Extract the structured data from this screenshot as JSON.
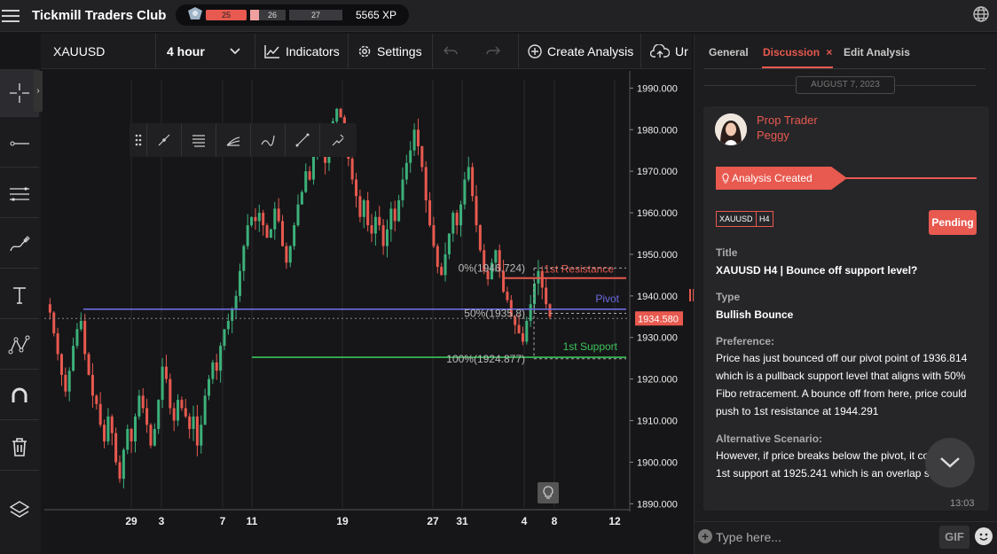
{
  "app": {
    "title": "Tickmill Traders Club"
  },
  "xp": {
    "seg1": "25",
    "seg2": "26",
    "seg3": "27",
    "value": "5565 XP"
  },
  "toolbar": {
    "symbol": "XAUUSD",
    "timeframe": "4 hour",
    "indicators": "Indicators",
    "settings": "Settings",
    "create_analysis": "Create Analysis",
    "upload": "Ur"
  },
  "chart_data": {
    "type": "candlestick",
    "symbol": "XAUUSD",
    "timeframe": "4 hour",
    "ylim": [
      1889,
      1992
    ],
    "y_ticks": [
      "1990.000",
      "1980.000",
      "1970.000",
      "1960.000",
      "1950.000",
      "1940.000",
      "1930.000",
      "1920.000",
      "1910.000",
      "1900.000",
      "1890.000"
    ],
    "x_ticks": [
      "29",
      "3",
      "7",
      "11",
      "19",
      "27",
      "31",
      "4",
      "8",
      "12"
    ],
    "current_price": "1934.580",
    "levels": [
      {
        "label": "1st Resistance",
        "price": 1944.291,
        "color": "#e8594f"
      },
      {
        "label": "Pivot",
        "price": 1936.814,
        "color": "#6c6ce0"
      },
      {
        "label": "1st Support",
        "price": 1925.241,
        "color": "#3cc35a"
      }
    ],
    "fib_labels": [
      "0%(1946.724)",
      "50%(1935.8)",
      "100%(1924.877)"
    ],
    "path": [
      1938,
      1936,
      1931,
      1926,
      1921,
      1917,
      1922,
      1928,
      1932,
      1934,
      1926,
      1921,
      1916,
      1914,
      1909,
      1905,
      1911,
      1907,
      1900,
      1896,
      1903,
      1908,
      1905,
      1911,
      1916,
      1913,
      1909,
      1904,
      1908,
      1915,
      1923,
      1920,
      1913,
      1910,
      1915,
      1913,
      1911,
      1908,
      1911,
      1904,
      1909,
      1916,
      1920,
      1924,
      1922,
      1928,
      1932,
      1934,
      1937,
      1940,
      1946,
      1952,
      1957,
      1959,
      1958,
      1960,
      1957,
      1954,
      1956,
      1961,
      1958,
      1952,
      1948,
      1952,
      1957,
      1962,
      1965,
      1970,
      1968,
      1975,
      1979,
      1977,
      1972,
      1976,
      1982,
      1985,
      1983,
      1976,
      1973,
      1968,
      1964,
      1959,
      1963,
      1957,
      1955,
      1959,
      1957,
      1952,
      1956,
      1961,
      1958,
      1963,
      1968,
      1972,
      1975,
      1980,
      1976,
      1971,
      1963,
      1957,
      1952,
      1947,
      1945,
      1950,
      1955,
      1960,
      1957,
      1962,
      1968,
      1971,
      1964,
      1957,
      1951,
      1946,
      1944,
      1948,
      1951,
      1946,
      1941,
      1939,
      1935,
      1933,
      1931,
      1929,
      1934,
      1938,
      1943,
      1946,
      1942,
      1938,
      1935
    ],
    "ohlc_note": ""
  },
  "side": {
    "tabs": [
      "General",
      "Discussion",
      "Edit Analysis"
    ],
    "date": "AUGUST 7, 2023",
    "author_role": "Prop Trader",
    "author_name": "Peggy",
    "banner": "Analysis Created",
    "tags": [
      "XAUUSD",
      "H4"
    ],
    "status": "Pending",
    "title_label": "Title",
    "title_value": "XAUUSD H4 | Bounce off support level?",
    "type_label": "Type",
    "type_value": "Bullish Bounce",
    "pref_label": "Preference:",
    "pref_lines": [
      "Price has just bounced off  our pivot point of 1936.814",
      "which is a pullback support level that aligns with 50%",
      "Fibo retracement. A bounce off from here, price could",
      "push to 1st resistance at 1944.291"
    ],
    "alt_label": "Alternative Scenario:",
    "alt_lines": [
      "However, if price breaks below the pivot, it co",
      "1st support at 1925.241 which is an overlap s"
    ],
    "time": "13:03",
    "input_placeholder": "Type here...",
    "gif": "GIF"
  }
}
